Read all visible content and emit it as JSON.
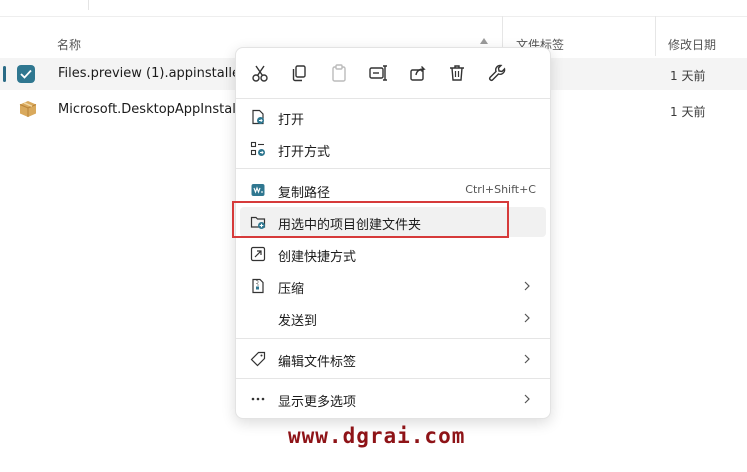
{
  "columns": {
    "name": "名称",
    "tags": "文件标签",
    "date": "修改日期"
  },
  "files": [
    {
      "name": "Files.preview (1).appinstaller",
      "date": "1 天前",
      "selected": true
    },
    {
      "name": "Microsoft.DesktopAppInstaller",
      "date": "1 天前",
      "selected": false
    }
  ],
  "context_menu": {
    "toolbar": [
      {
        "icon": "cut-icon"
      },
      {
        "icon": "copy-icon"
      },
      {
        "icon": "paste-icon"
      },
      {
        "icon": "rename-icon"
      },
      {
        "icon": "share-icon"
      },
      {
        "icon": "delete-icon"
      },
      {
        "icon": "properties-icon"
      }
    ],
    "items": [
      {
        "label": "打开",
        "icon": "open-icon"
      },
      {
        "label": "打开方式",
        "icon": "open-with-icon"
      },
      {
        "label": "复制路径",
        "icon": "copy-path-icon",
        "shortcut": "Ctrl+Shift+C"
      },
      {
        "label": "用选中的项目创建文件夹",
        "icon": "new-folder-icon"
      },
      {
        "label": "创建快捷方式",
        "icon": "shortcut-icon"
      },
      {
        "label": "压缩",
        "icon": "zip-icon",
        "submenu": true
      },
      {
        "label": "发送到",
        "icon": "",
        "submenu": true
      },
      {
        "label": "编辑文件标签",
        "icon": "tag-icon",
        "submenu": true
      },
      {
        "label": "显示更多选项",
        "icon": "more-icon",
        "submenu": true
      }
    ]
  },
  "watermark": "www.dgrai.com",
  "colors": {
    "accent": "#2f7790",
    "highlight": "#d63a3a",
    "watermark": "#8e1317"
  }
}
